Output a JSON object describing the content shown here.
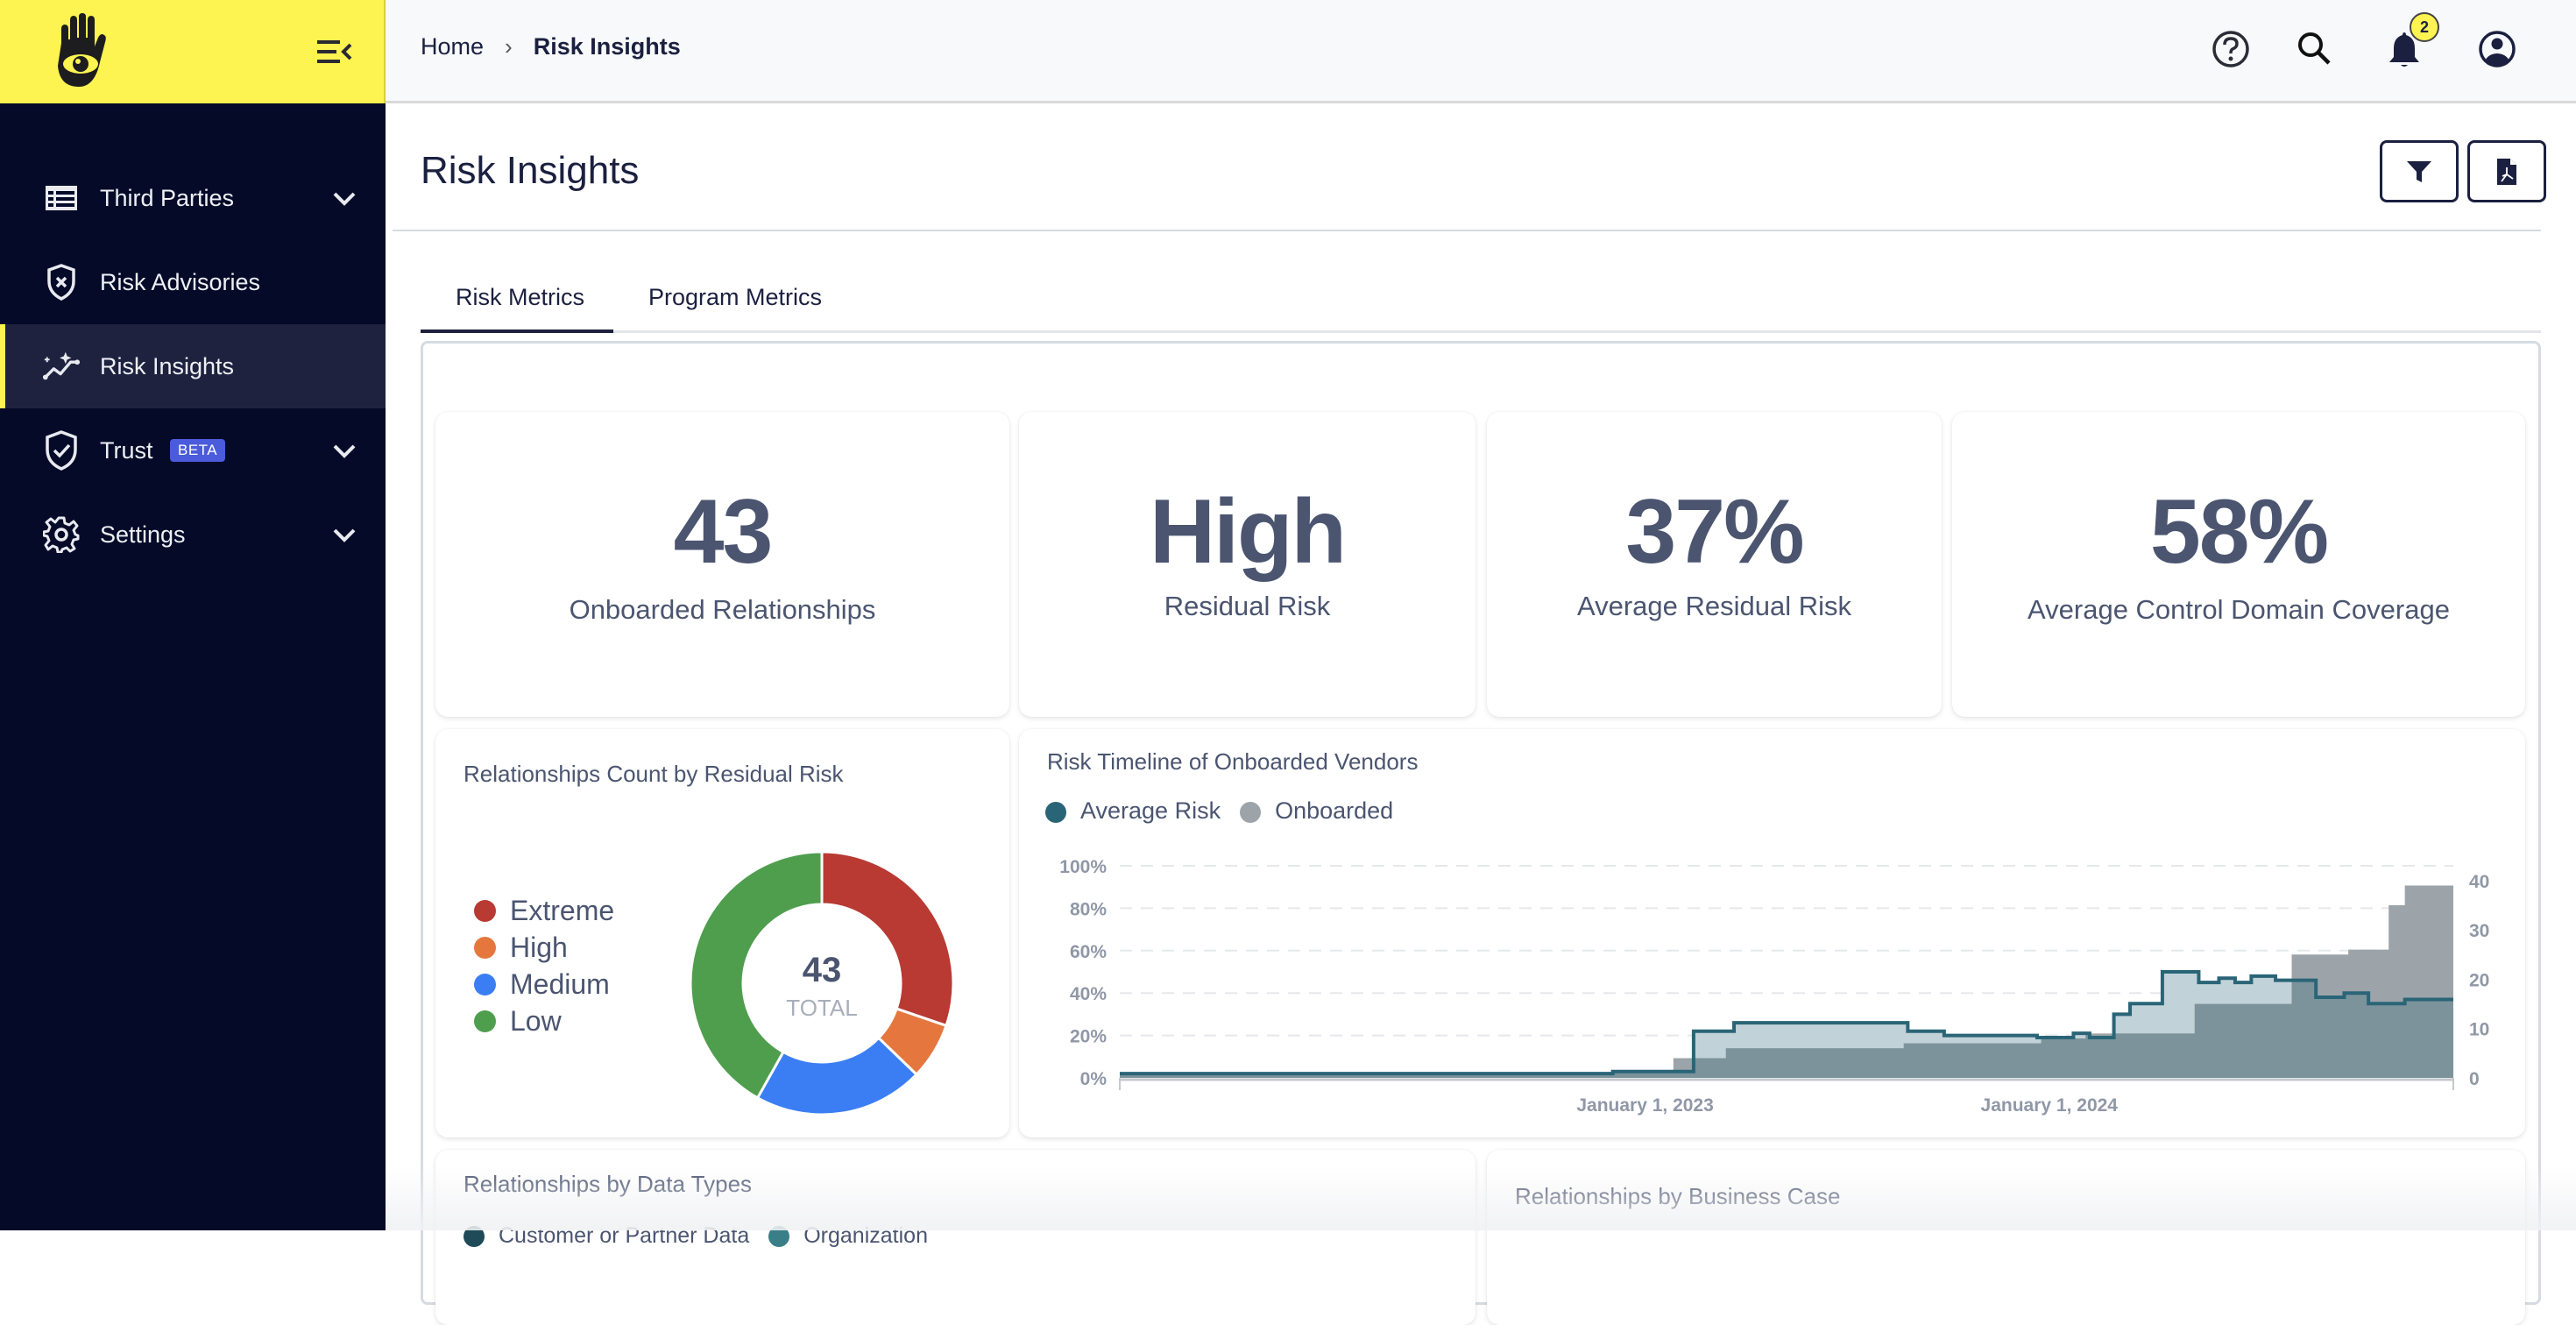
{
  "sidebar": {
    "collapse_icon": "menu-collapse-icon",
    "items": [
      {
        "label": "Third Parties",
        "icon": "table-list-icon",
        "expandable": true,
        "active": false
      },
      {
        "label": "Risk Advisories",
        "icon": "shield-x-icon",
        "expandable": false,
        "active": false
      },
      {
        "label": "Risk Insights",
        "icon": "sparkle-trend-icon",
        "expandable": false,
        "active": true
      },
      {
        "label": "Trust",
        "icon": "shield-check-icon",
        "expandable": true,
        "active": false,
        "badge": "BETA"
      },
      {
        "label": "Settings",
        "icon": "gear-icon",
        "expandable": true,
        "active": false
      }
    ]
  },
  "topbar": {
    "breadcrumb": {
      "home": "Home",
      "separator": "›",
      "current": "Risk Insights"
    },
    "icons": [
      "help-icon",
      "search-icon",
      "bell-icon",
      "user-icon"
    ],
    "notification_count": "2"
  },
  "page": {
    "title": "Risk Insights",
    "actions": [
      "filter-icon",
      "pdf-export-icon"
    ],
    "tabs": [
      {
        "label": "Risk Metrics",
        "active": true
      },
      {
        "label": "Program Metrics",
        "active": false
      }
    ]
  },
  "stats": [
    {
      "value": "43",
      "label": "Onboarded Relationships"
    },
    {
      "value": "High",
      "label": "Residual Risk"
    },
    {
      "value": "37%",
      "label": "Average Residual Risk"
    },
    {
      "value": "58%",
      "label": "Average Control Domain Coverage"
    }
  ],
  "bottom_cards": {
    "data_types": {
      "title": "Relationships by Data Types",
      "legend": [
        {
          "label": "Customer or Partner Data",
          "color": "#1F4A57"
        },
        {
          "label": "Organization",
          "color": "#3A7F87"
        }
      ]
    },
    "business_case": {
      "title": "Relationships by Business Case"
    }
  },
  "colors": {
    "brand_yellow": "#FDF351",
    "sidebar_bg": "#040A28",
    "active_bg": "#1E223F",
    "beta_badge": "#4A5BDC",
    "text_primary": "#1B2040",
    "text_muted": "#4B5570"
  },
  "chart_data": [
    {
      "type": "pie",
      "title": "Relationships Count by Residual Risk",
      "center_value": "43",
      "center_label": "TOTAL",
      "legend_position": "left",
      "categories": [
        "Extreme",
        "High",
        "Medium",
        "Low"
      ],
      "values": [
        13,
        3,
        9,
        18
      ],
      "colors": [
        "#B83A33",
        "#E5773E",
        "#3B7EF4",
        "#4E9E4E"
      ]
    },
    {
      "type": "area",
      "title": "Risk Timeline of Onboarded Vendors",
      "legend_position": "top-left",
      "series": [
        {
          "name": "Average Risk",
          "axis": "left",
          "color": "#2A6577",
          "step": true,
          "x": [
            2021.7,
            2022.92,
            2023.12,
            2023.22,
            2023.45,
            2023.65,
            2023.74,
            2023.97,
            2024.06,
            2024.1,
            2024.16,
            2024.2,
            2024.28,
            2024.37,
            2024.42,
            2024.46,
            2024.5,
            2024.56,
            2024.66,
            2024.73,
            2024.79,
            2024.88,
            2025.0
          ],
          "values": [
            2,
            3,
            22,
            26,
            26,
            22,
            20,
            19,
            21,
            19,
            30,
            35,
            50,
            45,
            47,
            45,
            48,
            46,
            38,
            40,
            35,
            37,
            37
          ]
        },
        {
          "name": "Onboarded",
          "axis": "right",
          "color": "#9DA4A9",
          "step": true,
          "x": [
            2021.7,
            2022.92,
            2023.07,
            2023.2,
            2023.64,
            2023.98,
            2024.09,
            2024.23,
            2024.36,
            2024.45,
            2024.6,
            2024.74,
            2024.84,
            2024.88,
            2025.0
          ],
          "values": [
            1,
            1,
            4,
            6,
            7,
            8,
            9,
            9,
            15,
            15,
            25,
            26,
            35,
            39,
            43
          ]
        }
      ],
      "x_ticks": [
        "January 1, 2023",
        "January 1, 2024"
      ],
      "x_tick_values": [
        2023.0,
        2024.0
      ],
      "xlim": [
        2021.7,
        2025.0
      ],
      "y_left": {
        "ticks": [
          "0%",
          "20%",
          "40%",
          "60%",
          "80%",
          "100%"
        ],
        "ylim": [
          0,
          100
        ]
      },
      "y_right": {
        "ticks": [
          "0",
          "10",
          "20",
          "30",
          "40"
        ],
        "ylim": [
          0,
          43
        ]
      },
      "grid": true
    }
  ]
}
